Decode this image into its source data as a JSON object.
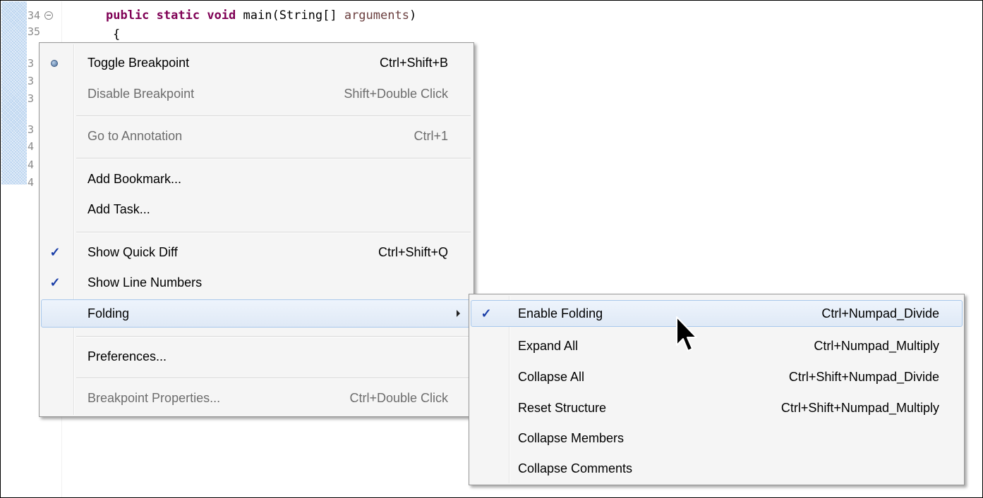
{
  "editor": {
    "line_numbers": [
      "34",
      "35",
      "3",
      "3",
      "3",
      "3",
      "4",
      "4",
      "4"
    ],
    "code_line": {
      "kw1": "public",
      "kw2": "static",
      "kw3": "void",
      "rest": " main(String[] ",
      "param": "arguments",
      "close": ")"
    },
    "brace": "{"
  },
  "context_menu": {
    "items": [
      {
        "label": "Toggle Breakpoint",
        "shortcut": "Ctrl+Shift+B",
        "icon": "breakpoint-dot-icon"
      },
      {
        "label": "Disable Breakpoint",
        "shortcut": "Shift+Double Click",
        "disabled": true
      },
      {
        "label": "Go to Annotation",
        "shortcut": "Ctrl+1",
        "disabled": true
      },
      {
        "label": "Add Bookmark...",
        "shortcut": ""
      },
      {
        "label": "Add Task...",
        "shortcut": ""
      },
      {
        "label": "Show Quick Diff",
        "shortcut": "Ctrl+Shift+Q",
        "checked": true
      },
      {
        "label": "Show Line Numbers",
        "shortcut": "",
        "checked": true
      },
      {
        "label": "Folding",
        "shortcut": "",
        "submenu": true,
        "highlighted": true
      },
      {
        "label": "Preferences...",
        "shortcut": ""
      },
      {
        "label": "Breakpoint Properties...",
        "shortcut": "Ctrl+Double Click",
        "disabled": true
      }
    ],
    "check_glyph": "✓"
  },
  "folding_submenu": {
    "items": [
      {
        "label": "Enable Folding",
        "shortcut": "Ctrl+Numpad_Divide",
        "checked": true,
        "highlighted": true
      },
      {
        "label": "Expand All",
        "shortcut": "Ctrl+Numpad_Multiply"
      },
      {
        "label": "Collapse All",
        "shortcut": "Ctrl+Shift+Numpad_Divide"
      },
      {
        "label": "Reset Structure",
        "shortcut": "Ctrl+Shift+Numpad_Multiply"
      },
      {
        "label": "Collapse Members",
        "shortcut": ""
      },
      {
        "label": "Collapse Comments",
        "shortcut": ""
      }
    ]
  },
  "colors": {
    "keyword": "#7f0055",
    "parameter": "#6a3e3e",
    "check": "#1a3ea8",
    "highlight_border": "#a8c8ec"
  }
}
